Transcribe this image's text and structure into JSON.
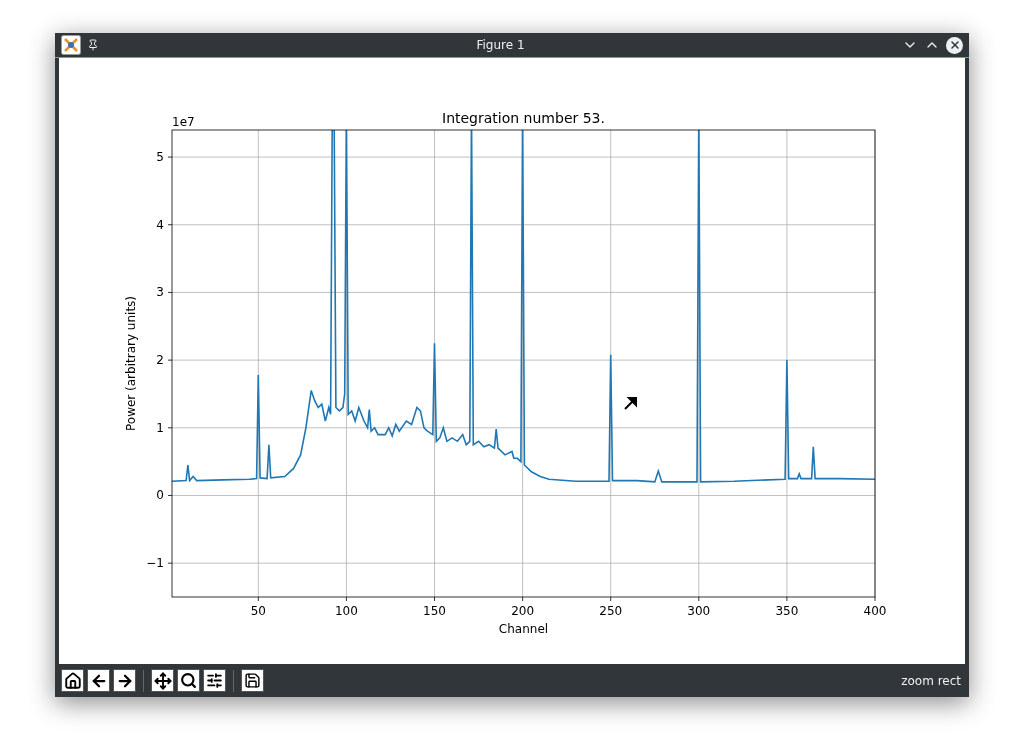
{
  "window": {
    "title": "Figure 1"
  },
  "figure": {
    "chart_data": {
      "type": "line",
      "title": "Integration number 53.",
      "xlabel": "Channel",
      "ylabel": "Power (arbitrary units)",
      "annotations": [
        {
          "text": "1e7"
        }
      ],
      "grid": true,
      "xlim": [
        1,
        400
      ],
      "ylim": [
        -1.5,
        5.4
      ],
      "xticks": [
        50,
        100,
        150,
        200,
        250,
        300,
        350,
        400
      ],
      "yticks": [
        {
          "value": -1,
          "label": "−1"
        },
        0,
        1,
        2,
        3,
        4,
        5
      ],
      "x": [
        1,
        9,
        10,
        11,
        13,
        15,
        30,
        45,
        49,
        50,
        51,
        55,
        56,
        57,
        65,
        70,
        74,
        77,
        80,
        82,
        84,
        86,
        88,
        90,
        91,
        92,
        93,
        94,
        96,
        98,
        99,
        100,
        101,
        103,
        105,
        107,
        110,
        112,
        113,
        114,
        116,
        118,
        122,
        124,
        126,
        128,
        130,
        134,
        137,
        140,
        142,
        144,
        146,
        149,
        150,
        151,
        153,
        155,
        157,
        160,
        163,
        166,
        168,
        170,
        171,
        172,
        175,
        178,
        181,
        184,
        185,
        186,
        190,
        194,
        195,
        197,
        199,
        200,
        201,
        205,
        210,
        215,
        230,
        249,
        250,
        251,
        265,
        275,
        277,
        279,
        299,
        300,
        301,
        320,
        349,
        350,
        351,
        356,
        357,
        358,
        364,
        365,
        366,
        380,
        400
      ],
      "series": [
        {
          "color": "#1f77b4",
          "values": [
            0.21,
            0.22,
            0.45,
            0.22,
            0.28,
            0.22,
            0.23,
            0.24,
            0.25,
            1.78,
            0.26,
            0.25,
            0.75,
            0.26,
            0.28,
            0.4,
            0.6,
            1.0,
            1.55,
            1.4,
            1.3,
            1.35,
            1.1,
            1.3,
            1.2,
            null,
            null,
            1.3,
            1.25,
            1.3,
            1.5,
            null,
            1.2,
            1.25,
            1.1,
            1.3,
            1.1,
            1.0,
            1.27,
            0.95,
            1.0,
            0.9,
            0.9,
            1.0,
            0.88,
            1.05,
            0.95,
            1.1,
            1.05,
            1.3,
            1.25,
            1.0,
            0.95,
            0.9,
            2.25,
            0.8,
            0.85,
            1.0,
            0.8,
            0.85,
            0.8,
            0.9,
            0.75,
            0.8,
            null,
            0.75,
            0.8,
            0.72,
            0.75,
            0.7,
            0.98,
            0.7,
            0.6,
            0.65,
            0.55,
            0.55,
            0.5,
            null,
            0.45,
            0.35,
            0.28,
            0.24,
            0.21,
            0.21,
            2.08,
            0.22,
            0.22,
            0.2,
            0.36,
            0.2,
            0.2,
            null,
            0.2,
            0.21,
            0.24,
            2.0,
            0.25,
            0.25,
            0.32,
            0.25,
            0.25,
            0.72,
            0.25,
            0.25,
            0.24
          ]
        }
      ]
    }
  },
  "status_bar": {
    "message": "zoom rect"
  }
}
